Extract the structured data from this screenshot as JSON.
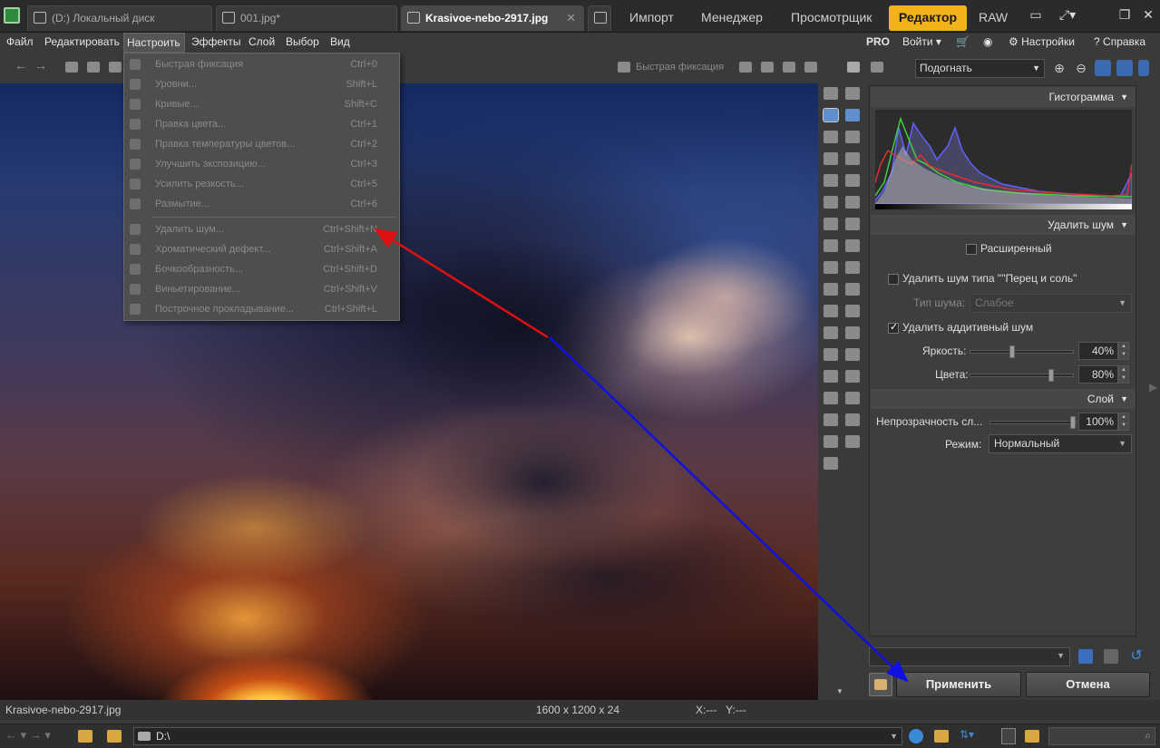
{
  "tabs": [
    {
      "label": "(D:) Локальный диск"
    },
    {
      "label": "001.jpg*"
    },
    {
      "label": "Krasivoe-nebo-2917.jpg"
    }
  ],
  "modes": [
    "Импорт",
    "Менеджер",
    "Просмотрщик",
    "Редактор",
    "RAW"
  ],
  "menu": [
    "Файл",
    "Редактировать",
    "Настроить",
    "Эффекты",
    "Слой",
    "Выбор",
    "Вид"
  ],
  "right_menu": {
    "pro": "PRO",
    "login": "Войти",
    "settings": "Настройки",
    "help": "Справка"
  },
  "toolbar": {
    "quick_fix": "Быстрая фиксация",
    "fit": "Подогнать"
  },
  "dropdown": [
    {
      "label": "Быстрая фиксация",
      "shortcut": "Ctrl+0",
      "icon": "quick-fix-icon"
    },
    {
      "label": "Уровни...",
      "shortcut": "Shift+L",
      "icon": "levels-icon"
    },
    {
      "label": "Кривые...",
      "shortcut": "Shift+C",
      "icon": "curves-icon"
    },
    {
      "label": "Правка цвета...",
      "shortcut": "Ctrl+1",
      "icon": "color-icon"
    },
    {
      "label": "Правка температуры цветов...",
      "shortcut": "Ctrl+2",
      "icon": "temperature-icon"
    },
    {
      "label": "Улучшить экспозицию...",
      "shortcut": "Ctrl+3",
      "icon": "exposure-icon"
    },
    {
      "label": "Усилить резкость...",
      "shortcut": "Ctrl+5",
      "icon": "sharpen-icon"
    },
    {
      "label": "Размытие...",
      "shortcut": "Ctrl+6",
      "icon": "blur-icon"
    },
    {
      "label": "Удалить шум...",
      "shortcut": "Ctrl+Shift+N",
      "icon": "noise-icon"
    },
    {
      "label": "Хроматический дефект...",
      "shortcut": "Ctrl+Shift+A",
      "icon": "chromatic-icon"
    },
    {
      "label": "Бочкообразность...",
      "shortcut": "Ctrl+Shift+D",
      "icon": "barrel-icon"
    },
    {
      "label": "Виньетирование...",
      "shortcut": "Ctrl+Shift+V",
      "icon": "vignette-icon"
    },
    {
      "label": "Построчное прокладывание...",
      "shortcut": "Ctrl+Shift+L",
      "icon": "scanline-icon"
    }
  ],
  "panel": {
    "histogram_title": "Гистограмма",
    "noise_title": "Удалить шум",
    "advanced": "Расширенный",
    "salt_pepper": "Удалить шум типа \"\"Перец и соль\"",
    "noise_type_label": "Тип шума:",
    "noise_type_value": "Слабое",
    "additive": "Удалить аддитивный шум",
    "brightness_label": "Яркость:",
    "brightness_value": "40%",
    "colors_label": "Цвета:",
    "colors_value": "80%",
    "layer_title": "Слой",
    "opacity_label": "Непрозрачность сл...",
    "opacity_value": "100%",
    "mode_label": "Режим:",
    "mode_value": "Нормальный",
    "brightness_level": 0.4,
    "colors_level": 0.8,
    "opacity_level": 1.0
  },
  "buttons": {
    "apply": "Применить",
    "cancel": "Отмена"
  },
  "status": {
    "file": "Krasivoe-nebo-2917.jpg",
    "dims": "1600 x 1200 x 24",
    "coords": "X:---   Y:---"
  },
  "bottom": {
    "path": "D:\\"
  },
  "colors": {
    "accent": "#f2b21a",
    "red_arrow": "#e01010",
    "blue_arrow": "#1010e0"
  }
}
